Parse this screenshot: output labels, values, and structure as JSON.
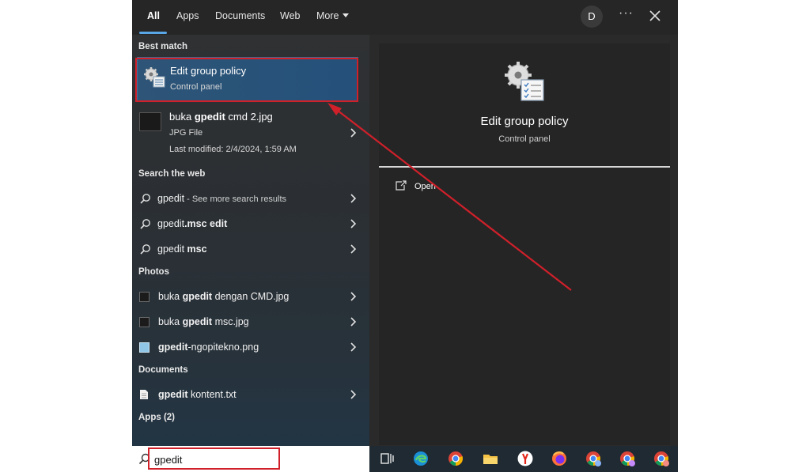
{
  "tabs": [
    {
      "label": "All",
      "active": true
    },
    {
      "label": "Apps"
    },
    {
      "label": "Documents"
    },
    {
      "label": "Web"
    },
    {
      "label": "More"
    }
  ],
  "header": {
    "avatar_initial": "D",
    "more_options": "···"
  },
  "best_match": {
    "section": "Best match",
    "title": "Edit group policy",
    "subtitle": "Control panel",
    "icon": "group-policy-gear-icon"
  },
  "file_result": {
    "name_prefix": "buka ",
    "name_bold": "gpedit",
    "name_suffix": " cmd 2.jpg",
    "type": "JPG File",
    "modified": "Last modified: 2/4/2024, 1:59 AM"
  },
  "search_web": {
    "section": "Search the web",
    "items": [
      {
        "prefix": "gpedit",
        "bold": "",
        "suffix": "",
        "note": " - See more search results"
      },
      {
        "prefix": "gpedit",
        "bold": ".msc edit",
        "suffix": "",
        "note": ""
      },
      {
        "prefix": "gpedit ",
        "bold": "msc",
        "suffix": "",
        "note": ""
      }
    ]
  },
  "photos": {
    "section": "Photos",
    "items": [
      {
        "prefix": "buka ",
        "bold": "gpedit",
        "suffix": " dengan CMD.jpg"
      },
      {
        "prefix": "buka ",
        "bold": "gpedit",
        "suffix": " msc.jpg"
      },
      {
        "prefix": "",
        "bold": "gpedit",
        "suffix": "-ngopitekno.png"
      }
    ]
  },
  "documents": {
    "section": "Documents",
    "items": [
      {
        "prefix": "",
        "bold": "gpedit",
        "suffix": " kontent.txt"
      }
    ]
  },
  "apps": {
    "section": "Apps (2)"
  },
  "preview": {
    "title": "Edit group policy",
    "subtitle": "Control panel",
    "open_label": "Open"
  },
  "search": {
    "value": "gpedit"
  },
  "taskbar": {
    "icons": [
      "task-view-icon",
      "edge-icon",
      "chrome-icon",
      "file-explorer-icon",
      "yandex-icon",
      "firefox-icon",
      "chrome-profile-icon",
      "chrome-profile-2-icon",
      "chrome-profile-3-icon"
    ]
  },
  "colors": {
    "annotation": "#d0202a",
    "accent": "#5aa7e8",
    "selected": "#24507a"
  }
}
